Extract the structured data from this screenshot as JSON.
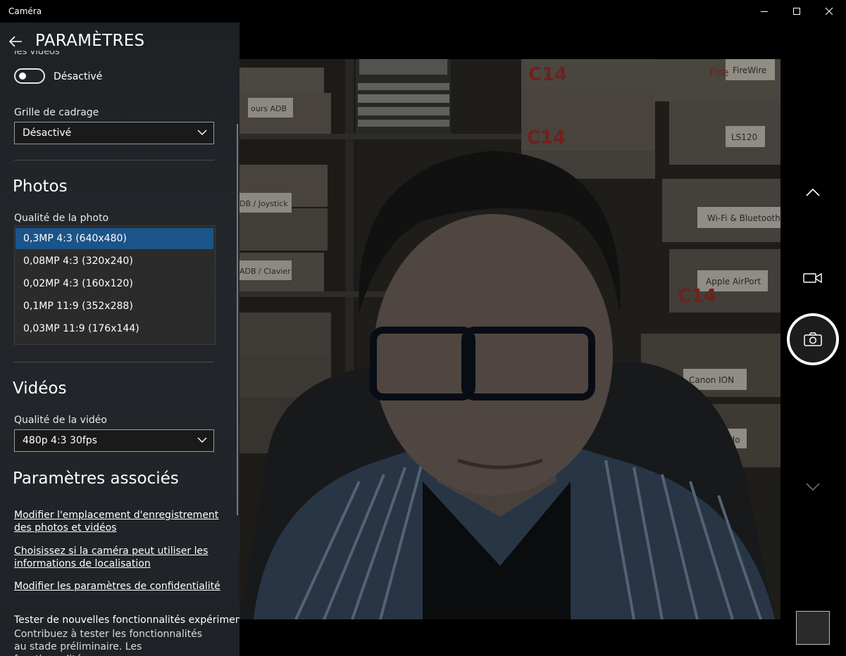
{
  "window": {
    "title": "Caméra",
    "controls": [
      "minimize-icon",
      "maximize-icon",
      "close-icon"
    ]
  },
  "settings": {
    "title": "PARAMÈTRES",
    "truncated_top_text": "les vidéos",
    "toggle": {
      "state": "off",
      "label": "Désactivé"
    },
    "framing_grid": {
      "label": "Grille de cadrage",
      "value": "Désactivé"
    },
    "photos": {
      "heading": "Photos",
      "quality_label": "Qualité de la photo",
      "options": [
        "0,3MP 4:3 (640x480)",
        "0,08MP 4:3 (320x240)",
        "0,02MP 4:3 (160x120)",
        "0,1MP 11:9 (352x288)",
        "0,03MP 11:9 (176x144)"
      ],
      "selected_index": 0
    },
    "videos": {
      "heading": "Vidéos",
      "quality_label": "Qualité de la vidéo",
      "value": "480p 4:3 30fps"
    },
    "related": {
      "heading": "Paramètres associés",
      "links": [
        "Modifier l'emplacement d'enregistrement des photos et vidéos",
        "Choisissez si la caméra peut utiliser les informations de localisation",
        "Modifier les paramètres de confidentialité"
      ]
    },
    "experimental": {
      "title": "Tester de nouvelles fonctionnalités expérimentales",
      "desc": "Contribuez à tester les fonctionnalités au stade préliminaire. Les fonctionnalités"
    }
  },
  "preview": {
    "box_labels": [
      "C14",
      "C14",
      "Fire",
      "FireWire",
      "LS120",
      "ours ADB",
      "DB / Joystick",
      "ADB / Clavier",
      "Wi-Fi & Bluetooth",
      "Apple AirPort",
      "C14",
      "Canon ION",
      "Nintendo"
    ]
  },
  "camera_controls": {
    "icons": [
      "chevron-up-icon",
      "video-camera-icon",
      "camera-icon",
      "chevron-down-icon"
    ]
  },
  "colors": {
    "panel": "#202225",
    "selected": "#1a5489",
    "accent_white": "#ffffff"
  }
}
